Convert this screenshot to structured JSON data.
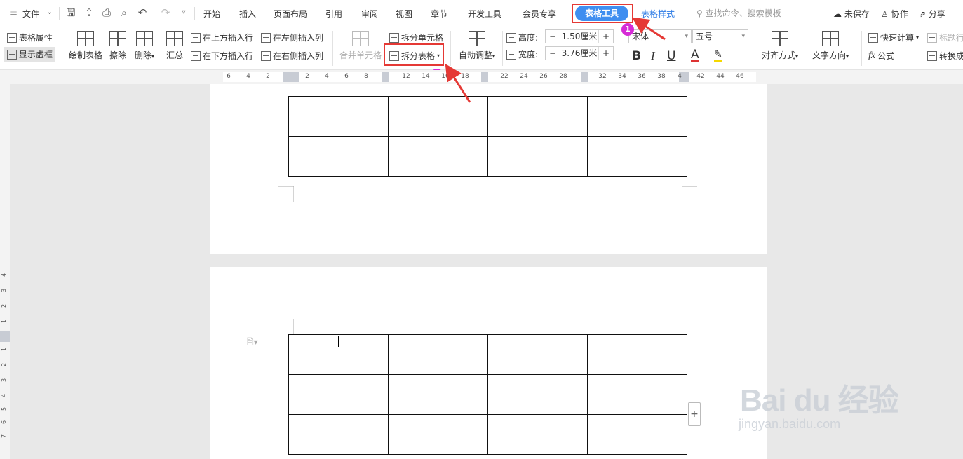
{
  "menu": {
    "file_label": "文件",
    "tabs": [
      "开始",
      "插入",
      "页面布局",
      "引用",
      "审阅",
      "视图",
      "章节",
      "开发工具",
      "会员专享"
    ],
    "active_tab": "表格工具",
    "style_tab": "表格样式",
    "search_placeholder": "查找命令、搜索模板",
    "unsaved": "未保存",
    "collab": "协作",
    "share": "分享"
  },
  "ribbon": {
    "table_props": "表格属性",
    "show_gridlines": "显示虚框",
    "draw_table": "绘制表格",
    "eraser": "擦除",
    "delete": "删除",
    "summary": "汇总",
    "insert_above": "在上方插入行",
    "insert_below": "在下方插入行",
    "insert_left": "在左侧插入列",
    "insert_right": "在右侧插入列",
    "merge_cells": "合并单元格",
    "split_cells": "拆分单元格",
    "split_table": "拆分表格",
    "auto_fit": "自动调整",
    "height_label": "高度:",
    "height_value": "1.50厘米",
    "width_label": "宽度:",
    "width_value": "3.76厘米",
    "font_name": "宋体",
    "font_size": "五号",
    "align": "对齐方式",
    "text_dir": "文字方向",
    "quick_calc": "快速计算",
    "title_row": "标题行",
    "formula": "公式",
    "convert": "转换成"
  },
  "badges": [
    "1",
    "2"
  ],
  "ruler": {
    "h_numbers": [
      "6",
      "4",
      "2",
      "2",
      "4",
      "6",
      "8",
      "12",
      "14",
      "16",
      "18",
      "22",
      "24",
      "26",
      "28",
      "32",
      "34",
      "36",
      "38",
      "4",
      "42",
      "44",
      "46"
    ],
    "v_numbers": [
      "4",
      "3",
      "2",
      "1",
      "1",
      "2",
      "3",
      "4",
      "5",
      "6",
      "7"
    ]
  },
  "watermark": {
    "brand": "Bai du 经验",
    "url": "jingyan.baidu.com"
  },
  "colors": {
    "accent": "#3f8ef0",
    "highlight": "#e53935",
    "badge": "#d62bd6"
  }
}
